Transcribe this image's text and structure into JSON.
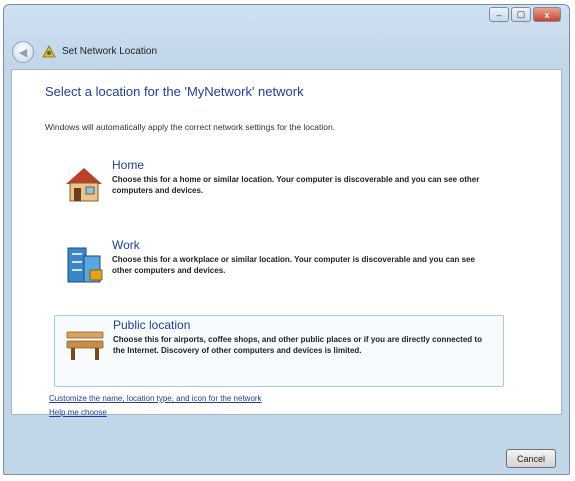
{
  "window": {
    "title": "Set Network Location",
    "caption_buttons": {
      "minimize": "–",
      "maximize": "▢",
      "close": "x"
    }
  },
  "content": {
    "heading": "Select a location for the 'MyNetwork' network",
    "intro": "Windows will automatically apply the correct network settings for the location.",
    "options": [
      {
        "title": "Home",
        "description": "Choose this for a home or similar location. Your computer is discoverable and you can see other computers and devices.",
        "icon": "house-icon"
      },
      {
        "title": "Work",
        "description": "Choose this for a workplace or similar location. Your computer is discoverable and you can see other computers and devices.",
        "icon": "office-building-icon"
      },
      {
        "title": "Public location",
        "description": "Choose this for airports, coffee shops, and other public places or if you are directly connected to the Internet. Discovery of other computers and devices is limited.",
        "icon": "park-bench-icon"
      }
    ],
    "links": {
      "customize": "Customize the name, location type, and icon for the network",
      "help": "Help me choose"
    }
  },
  "footer": {
    "cancel_label": "Cancel"
  },
  "colors": {
    "heading": "#1f3f9a",
    "frame": "#c2d6ea",
    "selected_border": "#9ecbe9"
  }
}
